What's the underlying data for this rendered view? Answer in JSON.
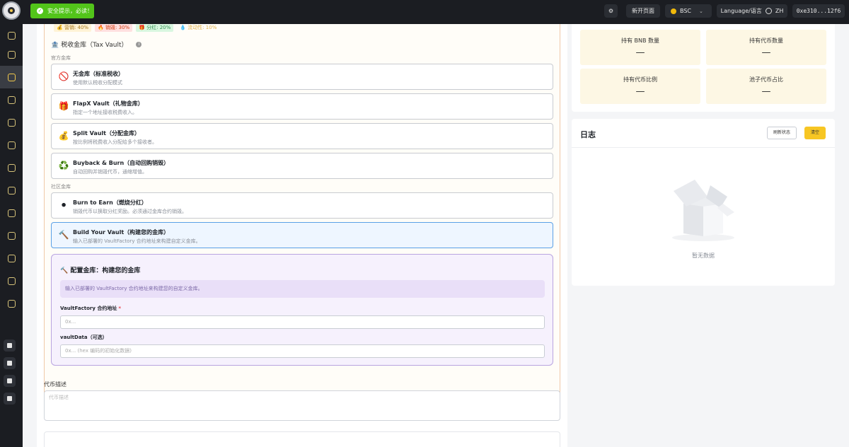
{
  "toast": {
    "text": "安全提示，必读！"
  },
  "topbar": {
    "new_page": "新开页面",
    "network": "BSC",
    "language": "Language/语言",
    "lang_code": "ZH",
    "address": "0xe310...12f6"
  },
  "sidebar": {
    "items": [
      "home-icon",
      "apps-icon",
      "launch-icon",
      "token-icon",
      "wallet-icon",
      "bell-icon",
      "ledger-icon",
      "swap-icon",
      "chart-icon",
      "download-icon",
      "user-icon",
      "transfer-icon",
      "shield-icon"
    ],
    "active_index": 2,
    "social": [
      "telegram-icon",
      "document-icon",
      "mail-icon",
      "link-icon"
    ]
  },
  "tax_chips": [
    "💰 营销: 40%",
    "🔥 销毁: 30%",
    "🎁 分红: 20%",
    "💧 流动性: 10%"
  ],
  "vault": {
    "title": "🏦 税收金库（Tax Vault）",
    "official_label": "官方金库",
    "community_label": "社区金库",
    "options": [
      {
        "emoji": "🚫",
        "title": "无金库（标准税收）",
        "desc": "使用默认税收分配模式"
      },
      {
        "emoji": "🎁",
        "title": "FlapX Vault（礼物金库）",
        "desc": "指定一个地址接收税费收入。"
      },
      {
        "emoji": "💰",
        "title": "Split Vault（分配金库）",
        "desc": "按比例将税费收入分配给多个接收者。"
      },
      {
        "emoji": "♻️",
        "title": "Buyback & Burn（自动回购销毁）",
        "desc": "自动回购并销毁代币，通缩增值。"
      },
      {
        "emoji": "⚫",
        "title": "Burn to Earn（燃烧分红）",
        "desc": "销毁代币以换取分红奖励。必须通过金库合约销毁。"
      },
      {
        "emoji": "🔨",
        "title": "Build Your Vault（构建您的金库）",
        "desc": "输入已部署的 VaultFactory 合约地址来构建自定义金库。"
      }
    ],
    "selected_index": 5
  },
  "build": {
    "title": "🔨 配置金库：构建您的金库",
    "note": "输入已部署的 VaultFactory 合约地址来构建您的自定义金库。",
    "factory_label": "VaultFactory 合约地址",
    "factory_required": "*",
    "factory_placeholder": "0x...",
    "data_label": "vaultData（可选）",
    "data_placeholder": "0x... (hex 编码的初始化数据)"
  },
  "description": {
    "label": "代币描述",
    "placeholder": "代币描述"
  },
  "stats": [
    {
      "label": "持有 BNB 数量",
      "value": "—"
    },
    {
      "label": "持有代币数量",
      "value": "—"
    },
    {
      "label": "持有代币比例",
      "value": "—"
    },
    {
      "label": "池子代币占比",
      "value": "—"
    }
  ],
  "log": {
    "title": "日志",
    "refresh": "刷新状态",
    "clear": "清空",
    "empty": "暂无数据"
  },
  "colors": {
    "accent": "#f7c623",
    "sidebar": "#1b1d22",
    "toast": "#52c41a",
    "selected_border": "#5aa0e6"
  }
}
